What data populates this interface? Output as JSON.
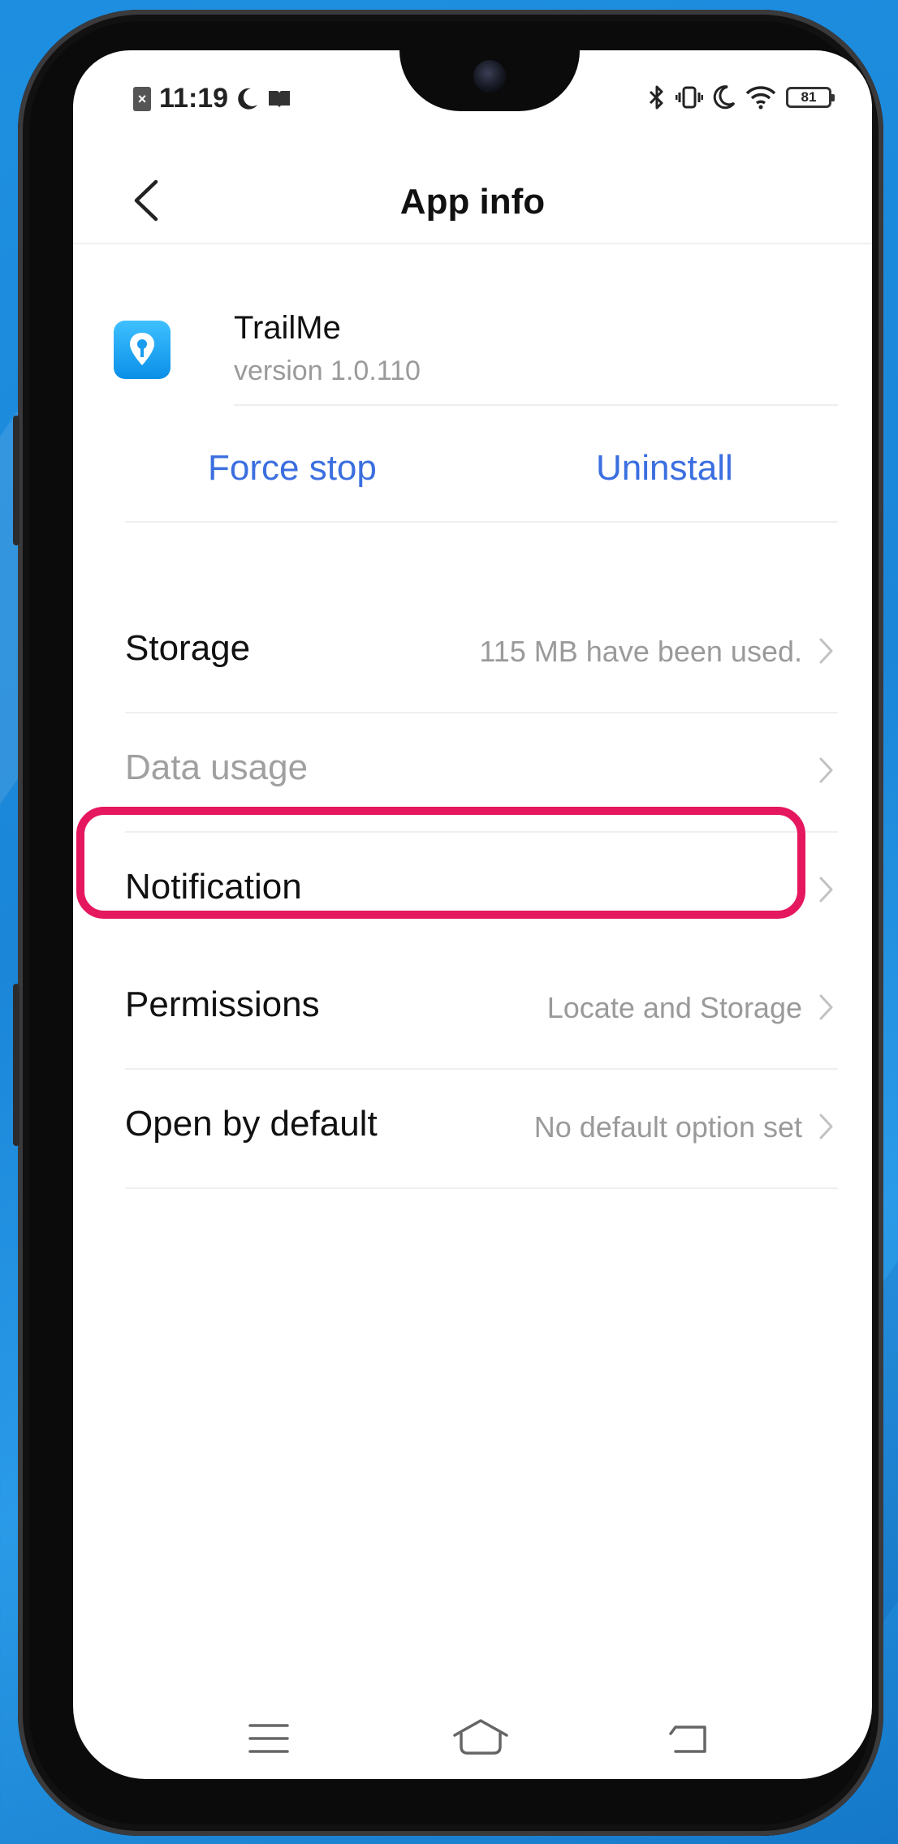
{
  "status_bar": {
    "time": "11:19",
    "battery": "81",
    "icons": [
      "sim-off-icon",
      "moon-icon",
      "book-icon",
      "bluetooth-icon",
      "vibrate-icon",
      "moon-icon",
      "wifi-icon",
      "battery-icon"
    ]
  },
  "header": {
    "title": "App info",
    "back_icon": "chevron-left-icon"
  },
  "app": {
    "name": "TrailMe",
    "version": "version 1.0.110",
    "icon": "location-pin-icon",
    "icon_color": "#1a9cf0"
  },
  "actions": {
    "force_stop": "Force stop",
    "uninstall": "Uninstall",
    "accent_color": "#3b6fe0"
  },
  "settings": [
    {
      "label": "Storage",
      "value": "115 MB have been used."
    },
    {
      "label": "Data usage",
      "value": ""
    },
    {
      "label": "Notification",
      "value": ""
    },
    {
      "label": "Permissions",
      "value": "Locate and Storage"
    },
    {
      "label": "Open by default",
      "value": "No default option set"
    }
  ],
  "highlight": {
    "target": "Notification",
    "color": "#e4175f"
  },
  "nav_bar": {
    "icons": [
      "menu-icon",
      "home-icon",
      "back-icon"
    ]
  }
}
